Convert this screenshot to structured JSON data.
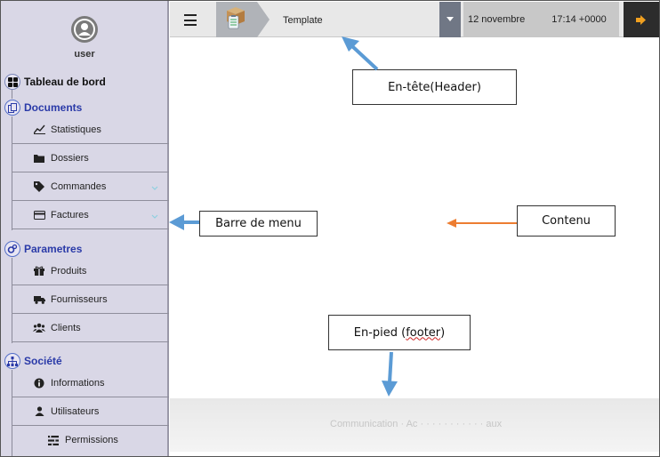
{
  "user": {
    "name": "user"
  },
  "sidebar": {
    "sections": [
      {
        "label": "Tableau de bord"
      },
      {
        "label": "Documents"
      },
      {
        "label": "Parametres"
      },
      {
        "label": "Société"
      }
    ],
    "documents_items": [
      {
        "label": "Statistiques"
      },
      {
        "label": "Dossiers"
      },
      {
        "label": "Commandes"
      },
      {
        "label": "Factures"
      }
    ],
    "parametres_items": [
      {
        "label": "Produits"
      },
      {
        "label": "Fournisseurs"
      },
      {
        "label": "Clients"
      }
    ],
    "societe_items": [
      {
        "label": "Informations"
      },
      {
        "label": "Utilisateurs"
      },
      {
        "label": "Permissions"
      }
    ]
  },
  "header": {
    "title": "Template",
    "date_text": "12 novembre",
    "time_text": "17:14 +0000"
  },
  "footer": {
    "text": "Communication · Ac · · · · · · · · · · · aux"
  },
  "annotations": {
    "header": "En-tête(Header)",
    "menu": "Barre de menu",
    "content": "Contenu",
    "footer_pre": "En-pied (",
    "footer_word": "footer",
    "footer_post": ")"
  },
  "colors": {
    "sidebar_bg": "#d9d7e6",
    "section_blue": "#2a3aa8",
    "arrow_blue": "#5b9bd5",
    "arrow_orange": "#ed7d31",
    "logout_bg": "#2c2c2c"
  }
}
